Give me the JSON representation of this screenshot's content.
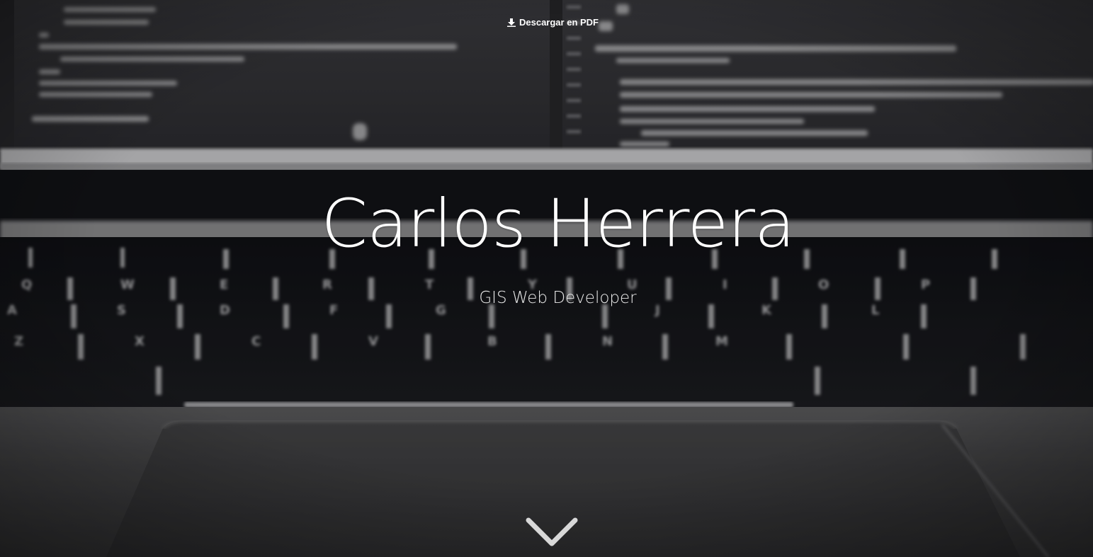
{
  "header": {
    "pdf_link_label": "Descargar en PDF",
    "pdf_icon": "download-icon"
  },
  "hero": {
    "name": "Carlos Herrera",
    "role": "GIS Web Developer",
    "scroll_icon": "chevron-down-icon",
    "background": "laptop-keyboard-photo",
    "colors": {
      "text": "#ffffff",
      "chevron": "#d8d8d8",
      "background_dark": "#16171b"
    }
  }
}
